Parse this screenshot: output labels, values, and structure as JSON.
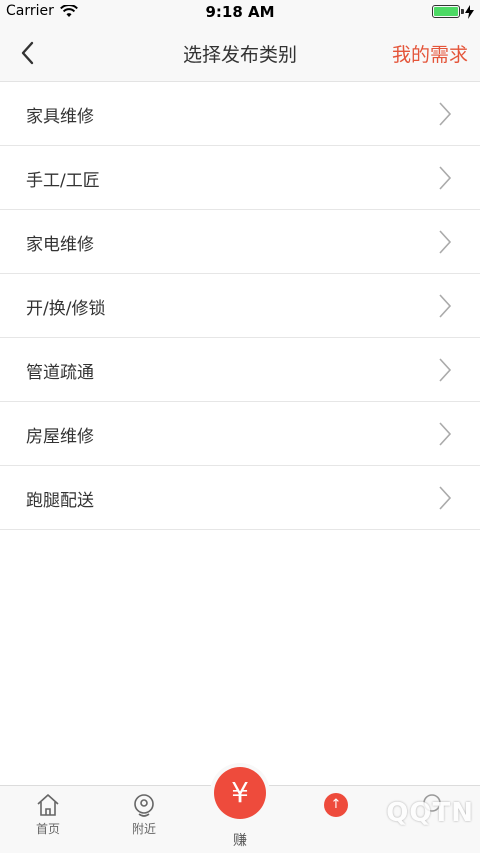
{
  "status": {
    "carrier": "Carrier",
    "time": "9:18 AM"
  },
  "nav": {
    "title": "选择发布类别",
    "action": "我的需求"
  },
  "categories": [
    {
      "label": "家具维修"
    },
    {
      "label": "手工/工匠"
    },
    {
      "label": "家电维修"
    },
    {
      "label": "开/换/修锁"
    },
    {
      "label": "管道疏通"
    },
    {
      "label": "房屋维修"
    },
    {
      "label": "跑腿配送"
    }
  ],
  "tabs": {
    "home": "首页",
    "nearby": "附近",
    "earn": "赚",
    "earn_symbol": "¥",
    "badge": "↑"
  },
  "watermark": "QQTN",
  "colors": {
    "accent": "#e4553a",
    "earn_button": "#ee4b3c"
  },
  "icons": [
    "wifi-icon",
    "battery-icon",
    "back-chevron-icon",
    "chevron-right-icon",
    "home-icon",
    "location-icon",
    "yuan-icon",
    "upload-icon"
  ]
}
